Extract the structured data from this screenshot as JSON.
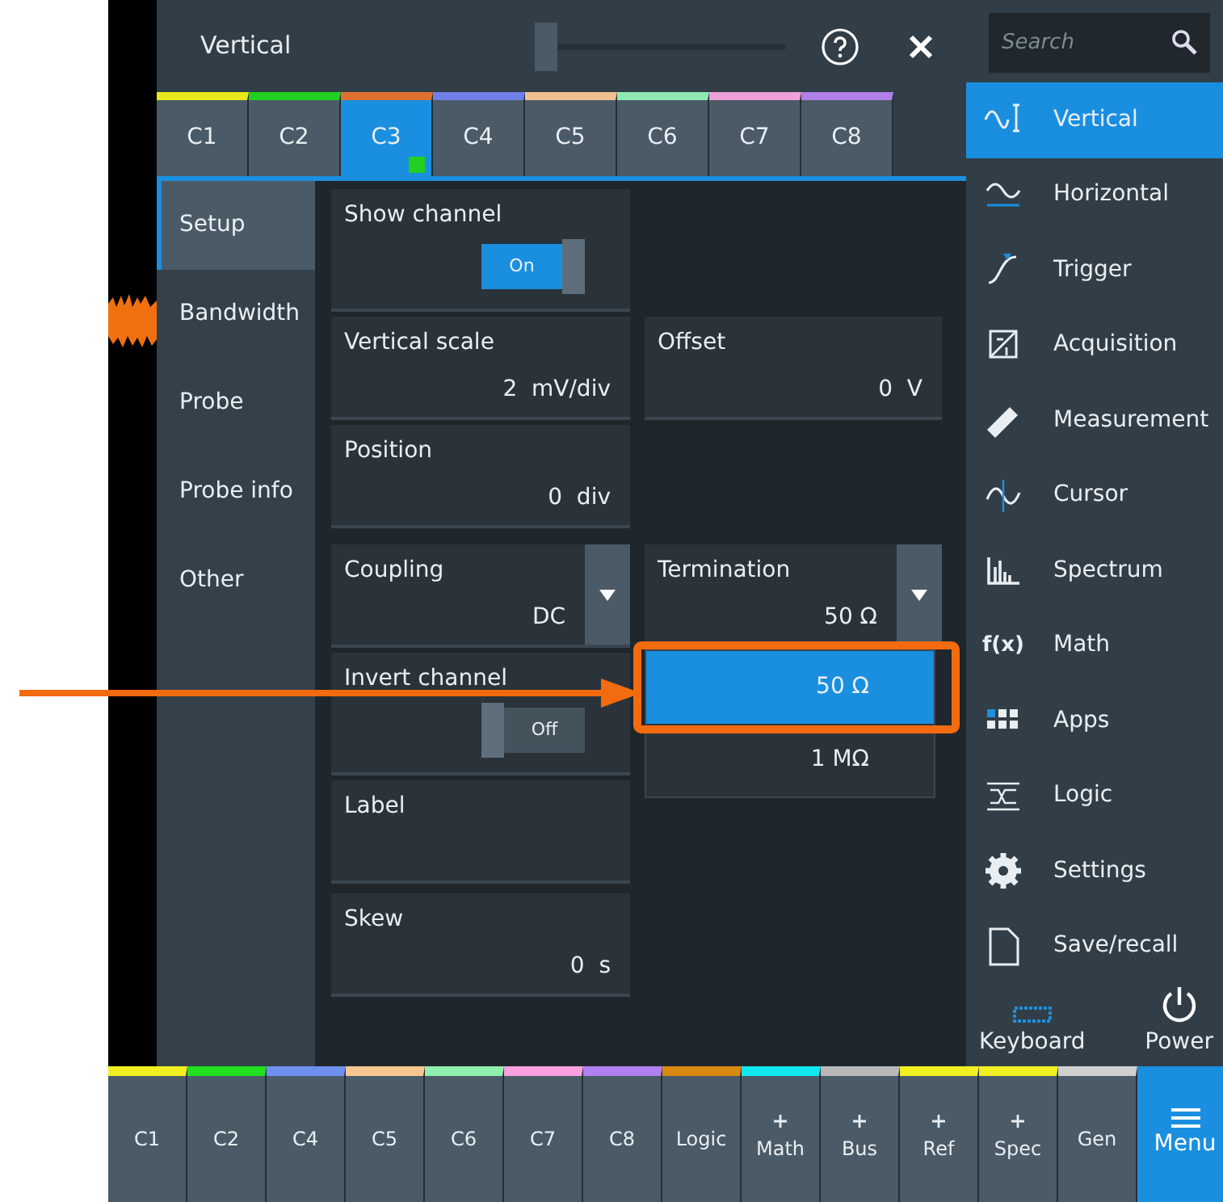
{
  "dialog": {
    "title": "Vertical",
    "slider": {
      "level": 0
    },
    "tabs": [
      {
        "label": "C1",
        "color": "#e8e81a",
        "selected": false
      },
      {
        "label": "C2",
        "color": "#22d022",
        "selected": false
      },
      {
        "label": "C3",
        "color": "#e07030",
        "selected": true
      },
      {
        "label": "C4",
        "color": "#7080e8",
        "selected": false
      },
      {
        "label": "C5",
        "color": "#f0c090",
        "selected": false
      },
      {
        "label": "C6",
        "color": "#90e8b0",
        "selected": false
      },
      {
        "label": "C7",
        "color": "#f0a0d8",
        "selected": false
      },
      {
        "label": "C8",
        "color": "#b080e8",
        "selected": false
      }
    ],
    "nav": [
      {
        "label": "Setup",
        "selected": true
      },
      {
        "label": "Bandwidth",
        "selected": false
      },
      {
        "label": "Probe",
        "selected": false
      },
      {
        "label": "Probe info",
        "selected": false
      },
      {
        "label": "Other",
        "selected": false
      }
    ],
    "fields": [
      {
        "kind": "toggle",
        "label": "Show channel",
        "text": "On",
        "on": true
      },
      {
        "kind": "value",
        "label": "Vertical scale",
        "value": "2  mV/div"
      },
      {
        "kind": "value",
        "label": "Offset",
        "value": "0  V"
      },
      {
        "kind": "value",
        "label": "Position",
        "value": "0  div"
      },
      {
        "kind": "select",
        "label": "Coupling",
        "value": "DC"
      },
      {
        "kind": "select",
        "label": "Termination",
        "value": "50 Ω",
        "expanded": true,
        "options": [
          {
            "label": "50 Ω",
            "selected": true
          },
          {
            "label": "1 MΩ",
            "selected": false
          }
        ]
      },
      {
        "kind": "toggle",
        "label": "Invert channel",
        "text": "Off",
        "on": false
      },
      {
        "kind": "value",
        "label": "Label"
      },
      {
        "kind": "value",
        "label": "Skew",
        "value": "0  s"
      }
    ]
  },
  "sidebar": {
    "search": {
      "placeholder": "Search"
    },
    "items": [
      {
        "label": "Vertical",
        "selected": true
      },
      {
        "label": "Horizontal",
        "selected": false
      },
      {
        "label": "Trigger",
        "selected": false
      },
      {
        "label": "Acquisition",
        "selected": false
      },
      {
        "label": "Measurement",
        "selected": false
      },
      {
        "label": "Cursor",
        "selected": false
      },
      {
        "label": "Spectrum",
        "selected": false
      },
      {
        "label": "Math",
        "selected": false,
        "icon_text": "f(x)"
      },
      {
        "label": "Apps",
        "selected": false
      },
      {
        "label": "Logic",
        "selected": false
      },
      {
        "label": "Settings",
        "selected": false
      },
      {
        "label": "Save/recall",
        "selected": false
      }
    ],
    "footer": [
      {
        "label": "Keyboard"
      },
      {
        "label": "Power"
      }
    ]
  },
  "bottom_bar": [
    {
      "label": "C1",
      "color": "#f0f020",
      "plus": false
    },
    {
      "label": "C2",
      "color": "#20e020",
      "plus": false
    },
    {
      "label": "C4",
      "color": "#7090f0",
      "plus": false
    },
    {
      "label": "C5",
      "color": "#f8c890",
      "plus": false
    },
    {
      "label": "C6",
      "color": "#90f0b0",
      "plus": false
    },
    {
      "label": "C7",
      "color": "#f8a0e0",
      "plus": false
    },
    {
      "label": "C8",
      "color": "#b080f0",
      "plus": false
    },
    {
      "label": "Logic",
      "color": "#d88a10",
      "plus": false
    },
    {
      "label": "Math",
      "color": "#10e8f0",
      "plus": true
    },
    {
      "label": "Bus",
      "color": "#b8b8b8",
      "plus": true
    },
    {
      "label": "Ref",
      "color": "#f0f020",
      "plus": true
    },
    {
      "label": "Spec",
      "color": "#f0f020",
      "plus": true
    },
    {
      "label": "Gen",
      "color": "#d0d0d0",
      "plus": false
    }
  ],
  "menu_button": {
    "label": "Menu"
  }
}
